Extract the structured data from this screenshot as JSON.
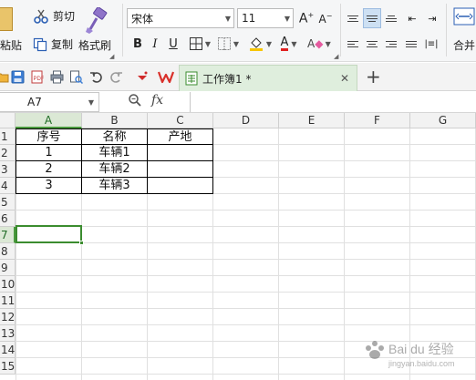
{
  "ribbon": {
    "paste_label": "粘贴",
    "cut_label": "剪切",
    "copy_label": "复制",
    "format_painter_label": "格式刷",
    "font_name": "宋体",
    "font_size": "11",
    "merge_label": "合并"
  },
  "quick_access": {
    "doc_tab_title": "工作簿1 *"
  },
  "formula_bar": {
    "name_box": "A7",
    "fx_label": "fx",
    "formula": ""
  },
  "sheet": {
    "columns": [
      "A",
      "B",
      "C",
      "D",
      "E",
      "F",
      "G"
    ],
    "rows": [
      "1",
      "2",
      "3",
      "4",
      "5",
      "6",
      "7",
      "8",
      "9",
      "10",
      "11",
      "12",
      "13",
      "14",
      "15"
    ],
    "active_column": "A",
    "active_row": "7",
    "cells": {
      "A1": "序号",
      "B1": "名称",
      "C1": "产地",
      "A2": "1",
      "B2": "车辆1",
      "C2": "",
      "A3": "2",
      "B3": "车辆2",
      "C3": "",
      "A4": "3",
      "B4": "车辆3",
      "C4": ""
    }
  },
  "colors": {
    "accent_green": "#3b8c2f",
    "wps_red": "#d9302a",
    "font_color_red": "#e02020",
    "fill_yellow": "#f7c600"
  },
  "watermark": {
    "line1": "Bai du 经验",
    "line2": "jingyan.baidu.com"
  }
}
